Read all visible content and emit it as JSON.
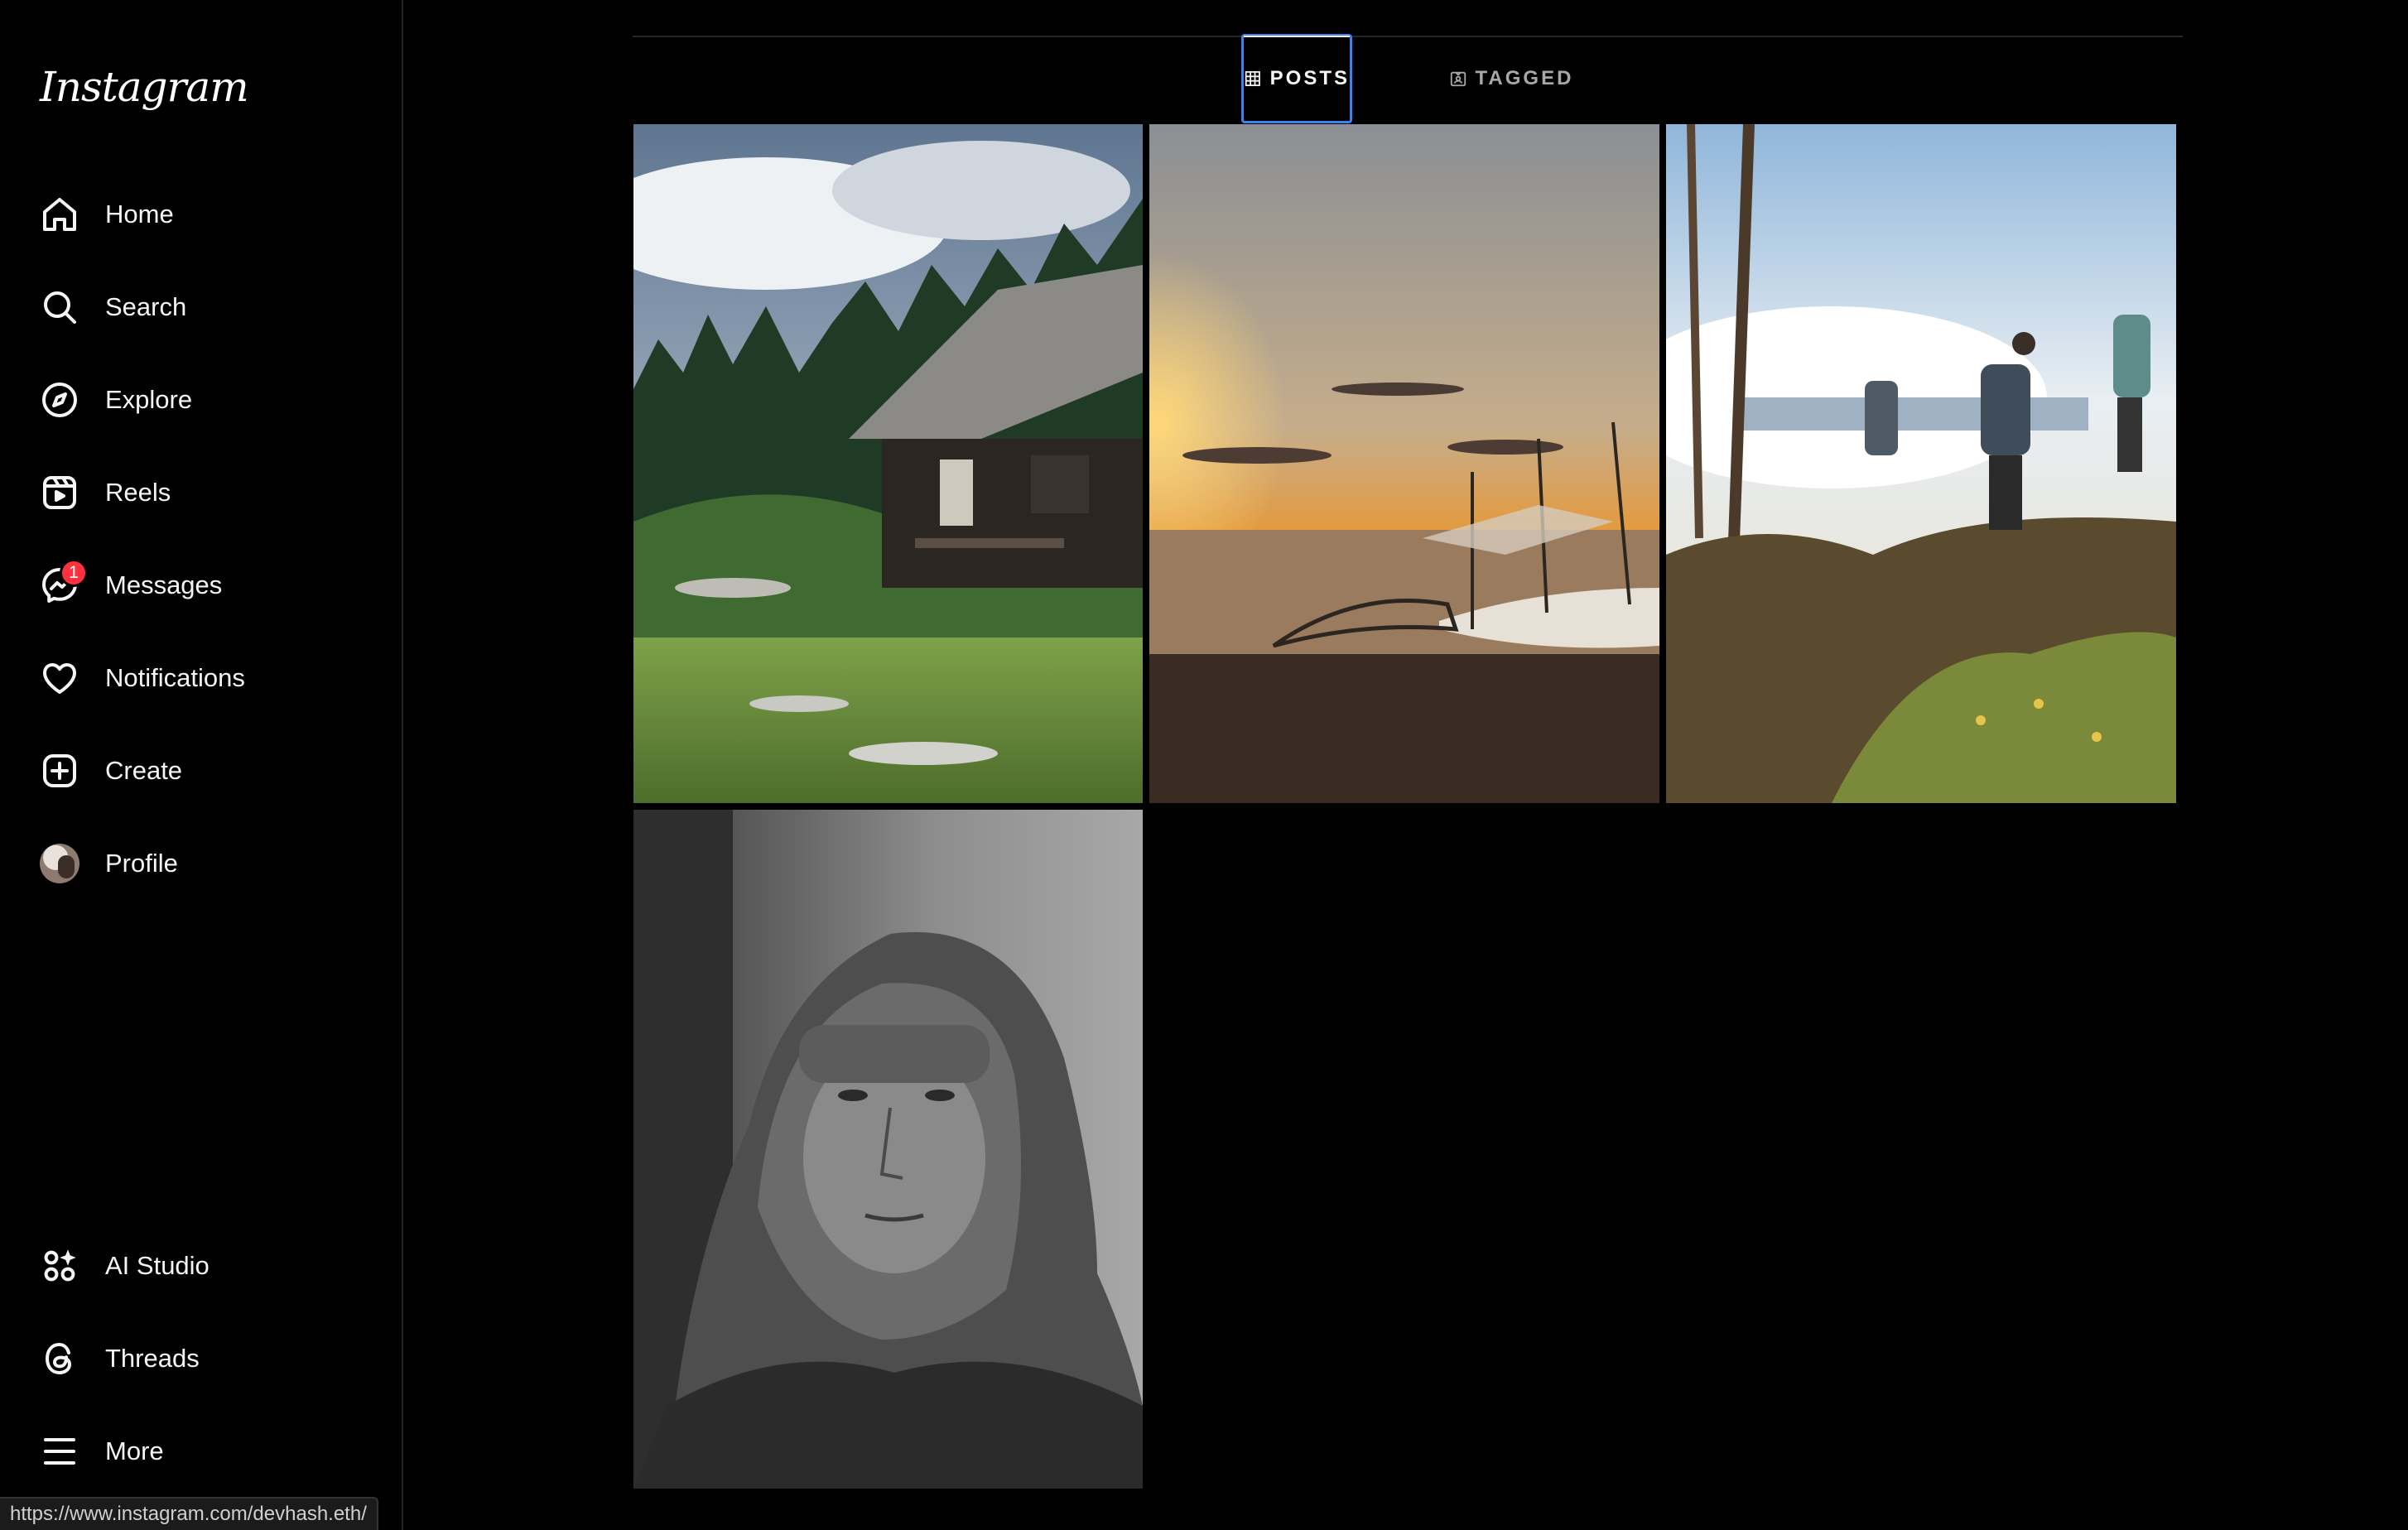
{
  "app": {
    "logo_text": "Instagram"
  },
  "sidebar": {
    "items": [
      {
        "label": "Home",
        "icon": "home-icon"
      },
      {
        "label": "Search",
        "icon": "search-icon"
      },
      {
        "label": "Explore",
        "icon": "compass-icon"
      },
      {
        "label": "Reels",
        "icon": "reels-icon"
      },
      {
        "label": "Messages",
        "icon": "messenger-icon",
        "badge": "1"
      },
      {
        "label": "Notifications",
        "icon": "heart-icon"
      },
      {
        "label": "Create",
        "icon": "plus-square-icon"
      },
      {
        "label": "Profile",
        "icon": "avatar"
      }
    ],
    "bottom_items": [
      {
        "label": "AI Studio",
        "icon": "ai-studio-icon"
      },
      {
        "label": "Threads",
        "icon": "threads-icon"
      },
      {
        "label": "More",
        "icon": "menu-icon"
      }
    ]
  },
  "profile": {
    "tabs": [
      {
        "label": "POSTS",
        "icon": "grid-icon",
        "active": true
      },
      {
        "label": "TAGGED",
        "icon": "tag-icon",
        "active": false
      }
    ],
    "posts": [
      {
        "subject": "mountain-cabin"
      },
      {
        "subject": "sunset-boat"
      },
      {
        "subject": "hikers"
      },
      {
        "subject": "portrait"
      }
    ]
  },
  "status_bar": {
    "url": "https://www.instagram.com/devhash.eth/"
  },
  "colors": {
    "accent": "#3b82f6",
    "badge": "#ff3040",
    "background": "#000000"
  }
}
